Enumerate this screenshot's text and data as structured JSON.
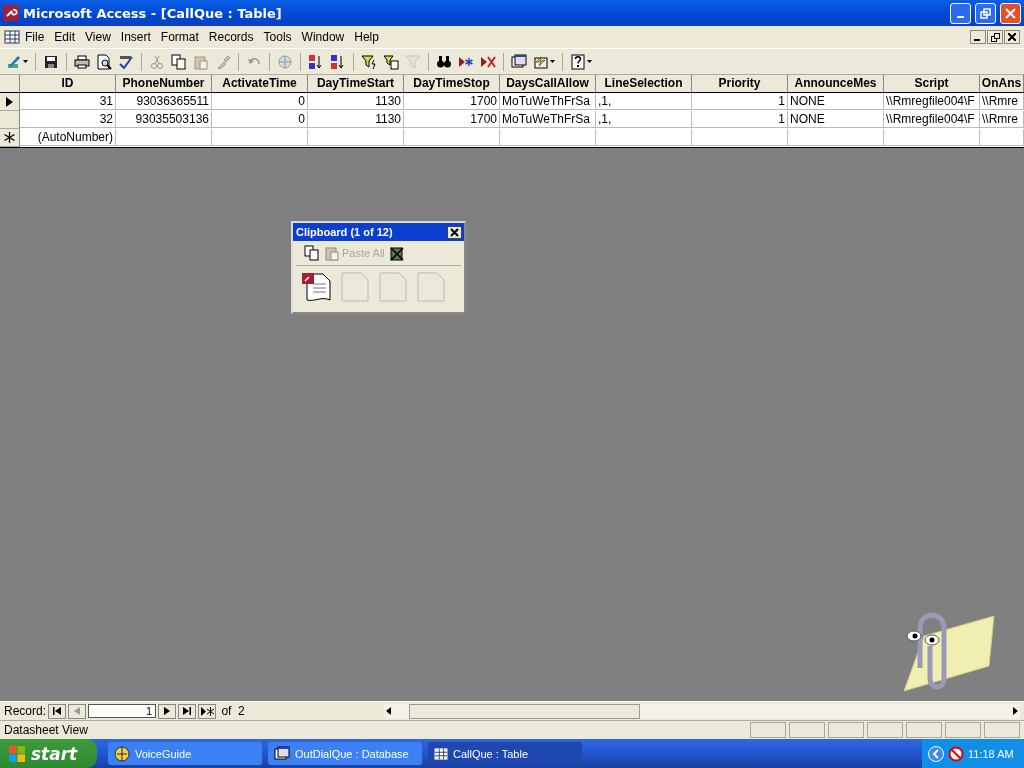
{
  "window": {
    "title": "Microsoft Access - [CallQue : Table]"
  },
  "menu": [
    "File",
    "Edit",
    "View",
    "Insert",
    "Format",
    "Records",
    "Tools",
    "Window",
    "Help"
  ],
  "toolbar": [
    [
      {
        "kind": "view",
        "disabled": false
      }
    ],
    [
      {
        "kind": "save",
        "disabled": false
      }
    ],
    [
      {
        "kind": "print",
        "disabled": false
      },
      {
        "kind": "preview",
        "disabled": false
      },
      {
        "kind": "spelling",
        "disabled": false
      }
    ],
    [
      {
        "kind": "cut",
        "disabled": true
      },
      {
        "kind": "copy",
        "disabled": false
      },
      {
        "kind": "paste",
        "disabled": true
      },
      {
        "kind": "painter",
        "disabled": true
      }
    ],
    [
      {
        "kind": "undo",
        "disabled": true
      }
    ],
    [
      {
        "kind": "hyperlink",
        "disabled": true
      }
    ],
    [
      {
        "kind": "sortasc",
        "disabled": false
      },
      {
        "kind": "sortdesc",
        "disabled": false
      }
    ],
    [
      {
        "kind": "filtersel",
        "disabled": false
      },
      {
        "kind": "filterform",
        "disabled": false
      },
      {
        "kind": "applyfilter",
        "disabled": true
      }
    ],
    [
      {
        "kind": "find",
        "disabled": false
      },
      {
        "kind": "newrecord",
        "disabled": false
      },
      {
        "kind": "deleterecord",
        "disabled": false
      }
    ],
    [
      {
        "kind": "dbwindow",
        "disabled": false
      },
      {
        "kind": "newobject",
        "disabled": false
      }
    ],
    [
      {
        "kind": "help",
        "disabled": false
      }
    ]
  ],
  "table": {
    "columns": [
      "ID",
      "PhoneNumber",
      "ActivateTime",
      "DayTimeStart",
      "DayTimeStop",
      "DaysCallAllow",
      "LineSelection",
      "Priority",
      "AnnounceMes",
      "Script",
      "OnAns"
    ],
    "rows": [
      {
        "kind": "record",
        "selected": true,
        "cells": [
          "31",
          "93036365511",
          "0",
          "1130",
          "1700",
          "MoTuWeThFrSa",
          ",1,",
          "1",
          "NONE",
          "\\\\Rmregfile004\\F",
          "\\\\Rmre"
        ]
      },
      {
        "kind": "record",
        "selected": false,
        "cells": [
          "32",
          "93035503136",
          "0",
          "1130",
          "1700",
          "MoTuWeThFrSa",
          ",1,",
          "1",
          "NONE",
          "\\\\Rmregfile004\\F",
          "\\\\Rmre"
        ]
      },
      {
        "kind": "new",
        "selected": false,
        "cells": [
          "(AutoNumber)",
          "",
          "",
          "",
          "",
          "",
          "",
          "",
          "",
          "",
          ""
        ]
      }
    ]
  },
  "clipboard": {
    "title": "Clipboard (1 of 12)",
    "paste_all": {
      "label": "Paste All",
      "disabled": true
    },
    "items": [
      {
        "kind": "access"
      },
      {
        "kind": "empty"
      },
      {
        "kind": "empty"
      },
      {
        "kind": "empty"
      }
    ]
  },
  "navigator": {
    "label": "Record:",
    "value": "1",
    "of": "of",
    "count": "2"
  },
  "status_bar": {
    "text": "Datasheet View"
  },
  "taskbar": {
    "start": "start",
    "tasks": [
      {
        "label": "VoiceGuide",
        "kind": "voice",
        "selected": false
      },
      {
        "label": "OutDialQue : Database",
        "kind": "database",
        "selected": false
      },
      {
        "label": "CallQue : Table",
        "kind": "table",
        "selected": true
      }
    ],
    "clock": "11:18 AM"
  }
}
